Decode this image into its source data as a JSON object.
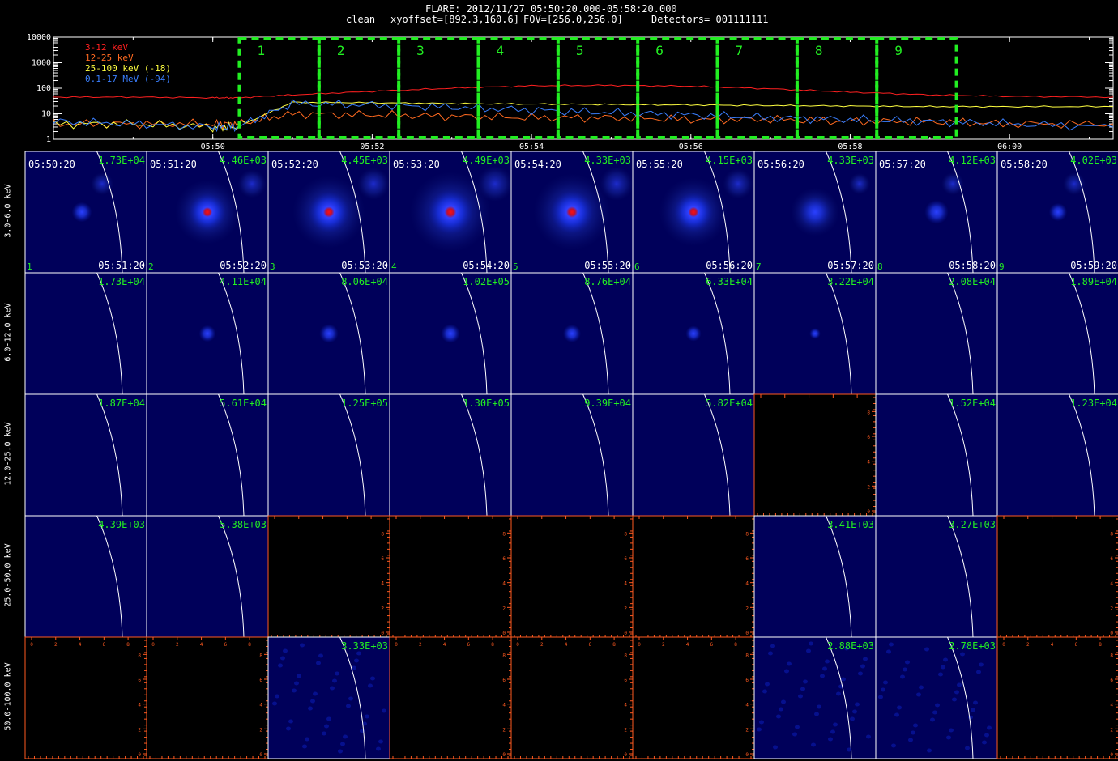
{
  "header": {
    "line1": "FLARE: 2012/11/27 05:50:20.000-05:58:20.000",
    "line2_clean": "clean",
    "line2_xy": "xyoffset=[892.3,160.6]",
    "line2_fov": "FOV=[256.0,256.0]",
    "line2_det": "Detectors= 001111111"
  },
  "lightcurve": {
    "legend": [
      {
        "label": "3-12 keV",
        "color": "#ff2020"
      },
      {
        "label": "12-25 keV",
        "color": "#ff6a20"
      },
      {
        "label": "25-100 keV (-18)",
        "color": "#ffff40"
      },
      {
        "label": "0.1-17 MeV (-94)",
        "color": "#3a7fff"
      }
    ],
    "ytick_labels": [
      "10000",
      "1000",
      "100",
      "10",
      "1"
    ],
    "xtick_labels": [
      "05:50",
      "05:52",
      "05:54",
      "05:56",
      "05:58",
      "06:00"
    ],
    "interval_labels": [
      "1",
      "2",
      "3",
      "4",
      "5",
      "6",
      "7",
      "8",
      "9"
    ],
    "interval_color": "#22ee22"
  },
  "chart_data": {
    "type": "line",
    "title": "FLARE: 2012/11/27 05:50:20.000-05:58:20.000",
    "yscale": "log",
    "ylim": [
      1,
      10000
    ],
    "xlim_minutes_after_0548": [
      0,
      13.3
    ],
    "x_minutes_after_0548": [
      0,
      1,
      2,
      2.3,
      3,
      4,
      5,
      6,
      7,
      8,
      9,
      10,
      11,
      12,
      13.3
    ],
    "series": [
      {
        "name": "3-12 keV",
        "color": "#ff2020",
        "values": [
          45,
          45,
          42,
          42,
          55,
          75,
          100,
          125,
          130,
          120,
          95,
          70,
          55,
          48,
          45
        ]
      },
      {
        "name": "12-25 keV",
        "color": "#ff6a20",
        "values": [
          4,
          4,
          4,
          4,
          10,
          9,
          8,
          7,
          7,
          6,
          6,
          5,
          5,
          4,
          4
        ]
      },
      {
        "name": "25-100 keV (-18)",
        "color": "#ffff40",
        "values": [
          4,
          4,
          3,
          3,
          28,
          27,
          25,
          24,
          23,
          22,
          21,
          20,
          19,
          19,
          19
        ]
      },
      {
        "name": "0.1-17 MeV (-94)",
        "color": "#3a7fff",
        "values": [
          5,
          4,
          3,
          3,
          25,
          22,
          18,
          14,
          11,
          9,
          7,
          6,
          5,
          4,
          3
        ]
      }
    ],
    "image_grid": {
      "rows": [
        "3.0-6.0 keV",
        "6.0-12.0 keV",
        "12.0-25.0 keV",
        "25.0-50.0 keV",
        "50.0-100.0 keV"
      ],
      "columns": [
        {
          "start": "05:50:20",
          "end": "05:51:20",
          "index": "1"
        },
        {
          "start": "05:51:20",
          "end": "05:52:20",
          "index": "2"
        },
        {
          "start": "05:52:20",
          "end": "05:53:20",
          "index": "3"
        },
        {
          "start": "05:53:20",
          "end": "05:54:20",
          "index": "4"
        },
        {
          "start": "05:54:20",
          "end": "05:55:20",
          "index": "5"
        },
        {
          "start": "05:55:20",
          "end": "05:56:20",
          "index": "6"
        },
        {
          "start": "05:56:20",
          "end": "05:57:20",
          "index": "7"
        },
        {
          "start": "05:57:20",
          "end": "05:58:20",
          "index": "8"
        },
        {
          "start": "05:58:20",
          "end": "05:59:20",
          "index": "9"
        }
      ],
      "max_values": [
        [
          "1.73E+04",
          "4.46E+03",
          "4.45E+03",
          "4.49E+03",
          "4.33E+03",
          "4.15E+03",
          "4.33E+03",
          "4.12E+03",
          "4.02E+03"
        ],
        [
          "1.73E+04",
          "4.11E+04",
          "8.06E+04",
          "1.02E+05",
          "8.76E+04",
          "6.33E+04",
          "3.22E+04",
          "2.08E+04",
          "1.89E+04"
        ],
        [
          "1.87E+04",
          "5.61E+04",
          "1.25E+05",
          "1.30E+05",
          "9.39E+04",
          "5.82E+04",
          "",
          "1.52E+04",
          "1.23E+04"
        ],
        [
          "4.39E+03",
          "5.38E+03",
          "",
          "",
          "",
          "",
          "3.41E+03",
          "3.27E+03",
          ""
        ],
        [
          "",
          "",
          "3.33E+03",
          "",
          "",
          "",
          "2.88E+03",
          "2.78E+03",
          ""
        ]
      ],
      "source_intensity": [
        [
          0.35,
          0.8,
          0.9,
          1.0,
          0.95,
          0.85,
          0.6,
          0.45,
          0.3
        ],
        [
          0,
          0.45,
          0.55,
          0.55,
          0.5,
          0.4,
          0.2,
          0,
          0
        ],
        [
          0,
          0,
          0,
          0,
          0,
          0,
          0,
          0,
          0
        ],
        [
          0,
          0,
          0,
          0,
          0,
          0,
          0,
          0,
          0
        ],
        [
          0,
          0,
          0,
          0,
          0,
          0,
          0,
          0,
          0
        ]
      ],
      "axis_tick_labels": [
        "0",
        "2",
        "4",
        "6",
        "8"
      ],
      "axis_color": "#ff5a20"
    }
  }
}
